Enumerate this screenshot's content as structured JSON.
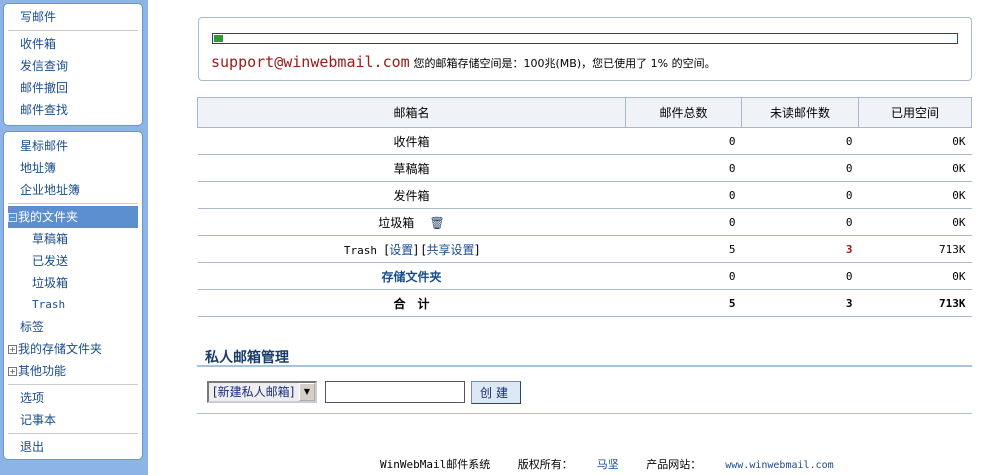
{
  "sidebar": {
    "panel1": [
      "写邮件",
      "收件箱",
      "发信查询",
      "邮件撤回",
      "邮件查找"
    ],
    "panel2": {
      "starred": "星标邮件",
      "addressbook": "地址簿",
      "corp_addressbook": "企业地址簿",
      "my_folders": "我的文件夹",
      "folders": [
        "草稿箱",
        "已发送",
        "垃圾箱",
        "Trash"
      ],
      "labels": "标签",
      "storage_folders": "我的存储文件夹",
      "other": "其他功能",
      "options": "选项",
      "notepad": "记事本",
      "logout": "退出"
    }
  },
  "quota": {
    "email": "support@winwebmail.com",
    "info": "您的邮箱存储空间是：100兆(MB)，您已使用了 1% 的空间。",
    "used_percent": 1
  },
  "table": {
    "headers": [
      "邮箱名",
      "邮件总数",
      "未读邮件数",
      "已用空间"
    ],
    "rows": [
      {
        "name": "收件箱",
        "total": "0",
        "unread": "0",
        "used": "0K"
      },
      {
        "name": "草稿箱",
        "total": "0",
        "unread": "0",
        "used": "0K"
      },
      {
        "name": "发件箱",
        "total": "0",
        "unread": "0",
        "used": "0K"
      },
      {
        "name": "垃圾箱",
        "total": "0",
        "unread": "0",
        "used": "0K"
      },
      {
        "name": "Trash",
        "settings": "设置",
        "share": "共享设置",
        "total": "5",
        "unread": "3",
        "used": "713K"
      },
      {
        "name": "存储文件夹",
        "total": "0",
        "unread": "0",
        "used": "0K"
      }
    ],
    "total": {
      "label": "合　计",
      "total": "5",
      "unread": "3",
      "used": "713K"
    }
  },
  "private": {
    "title": "私人邮箱管理",
    "select": "[新建私人邮箱]",
    "input": "",
    "create": "创建"
  },
  "footer": {
    "system": "WinWebMail邮件系统",
    "copyright": "版权所有：",
    "owner": "马坚",
    "site_label": "产品网站：",
    "site": "www.winwebmail.com"
  }
}
